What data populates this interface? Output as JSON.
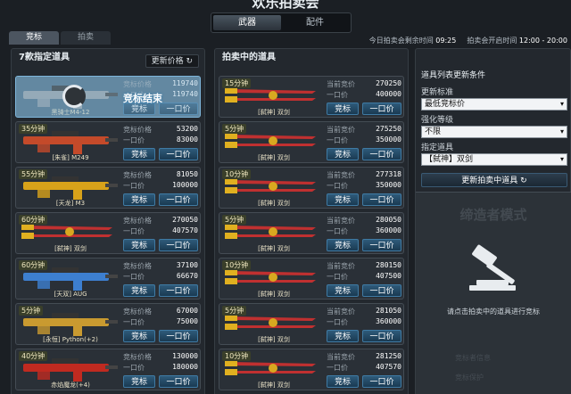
{
  "header": {
    "title": "欢乐拍卖会"
  },
  "category_tabs": [
    {
      "label": "武器"
    },
    {
      "label": "配件"
    }
  ],
  "sub_tabs": [
    {
      "label": "竞标"
    },
    {
      "label": "拍卖"
    }
  ],
  "timer": {
    "remaining_label": "今日拍卖会剩余时间",
    "remaining_value": "09:25",
    "open_label": "拍卖会开启时间",
    "open_value": "12:00 - 20:00"
  },
  "left_panel": {
    "title": "7款指定道具",
    "refresh_label": "更新价格",
    "items": [
      {
        "time": "",
        "name": "黑骑士M4-12",
        "label1": "竞标价格",
        "value1": "119740",
        "label2": "一口价",
        "value2": "119740",
        "bid": "竞标",
        "buy": "一口价",
        "ended": "竞标结束",
        "color": "#9aa1a8"
      },
      {
        "time": "35分钟",
        "name": "[朱雀] M249",
        "label1": "竞标价格",
        "value1": "53200",
        "label2": "一口价",
        "value2": "83000",
        "bid": "竞标",
        "buy": "一口价",
        "color": "#c44a2a"
      },
      {
        "time": "55分钟",
        "name": "[天龙] M3",
        "label1": "竞标价格",
        "value1": "81050",
        "label2": "一口价",
        "value2": "100000",
        "bid": "竞标",
        "buy": "一口价",
        "color": "#d8a21a"
      },
      {
        "time": "60分钟",
        "name": "[弑神] 双剑",
        "label1": "竞标价格",
        "value1": "270050",
        "label2": "一口价",
        "value2": "407570",
        "bid": "竞标",
        "buy": "一口价",
        "color": "#d03030"
      },
      {
        "time": "60分钟",
        "name": "[天双] AUG",
        "label1": "竞标价格",
        "value1": "37100",
        "label2": "一口价",
        "value2": "66670",
        "bid": "竞标",
        "buy": "一口价",
        "color": "#3d7fd0"
      },
      {
        "time": "5分钟",
        "name": "[永恒] Python(+2)",
        "label1": "竞标价格",
        "value1": "67000",
        "label2": "一口价",
        "value2": "75000",
        "bid": "竞标",
        "buy": "一口价",
        "color": "#c99a30"
      },
      {
        "time": "40分钟",
        "name": "赤焰魔龙(+4)",
        "label1": "竞标价格",
        "value1": "130000",
        "label2": "一口价",
        "value2": "180000",
        "bid": "竞标",
        "buy": "一口价",
        "color": "#c02a20"
      }
    ]
  },
  "mid_panel": {
    "title": "拍卖中的道具",
    "items": [
      {
        "time": "15分钟",
        "name": "[弑神] 双剑",
        "label1": "当前竞价",
        "value1": "270250",
        "label2": "一口价",
        "value2": "400000",
        "bid": "竞标",
        "buy": "一口价"
      },
      {
        "time": "5分钟",
        "name": "[弑神] 双剑",
        "label1": "当前竞价",
        "value1": "275250",
        "label2": "一口价",
        "value2": "350000",
        "bid": "竞标",
        "buy": "一口价"
      },
      {
        "time": "10分钟",
        "name": "[弑神] 双剑",
        "label1": "当前竞价",
        "value1": "277318",
        "label2": "一口价",
        "value2": "350000",
        "bid": "竞标",
        "buy": "一口价"
      },
      {
        "time": "5分钟",
        "name": "[弑神] 双剑",
        "label1": "当前竞价",
        "value1": "280050",
        "label2": "一口价",
        "value2": "360000",
        "bid": "竞标",
        "buy": "一口价"
      },
      {
        "time": "10分钟",
        "name": "[弑神] 双剑",
        "label1": "当前竞价",
        "value1": "280150",
        "label2": "一口价",
        "value2": "407500",
        "bid": "竞标",
        "buy": "一口价"
      },
      {
        "time": "5分钟",
        "name": "[弑神] 双剑",
        "label1": "当前竞价",
        "value1": "281050",
        "label2": "一口价",
        "value2": "360000",
        "bid": "竞标",
        "buy": "一口价"
      },
      {
        "time": "10分钟",
        "name": "[弑神] 双剑",
        "label1": "当前竞价",
        "value1": "281250",
        "label2": "一口价",
        "value2": "407570",
        "bid": "竞标",
        "buy": "一口价"
      }
    ]
  },
  "right_panel": {
    "filter_title": "道具列表更新条件",
    "sort_label": "更新标准",
    "sort_value": "最低竞标价",
    "enhance_label": "强化等级",
    "enhance_value": "不限",
    "item_label": "指定道具",
    "item_value": "【弑神】双剑",
    "refresh_button": "更新拍卖中道具",
    "creator_title": "缔造者模式",
    "creator_hint": "请点击拍卖中的道具进行竞标",
    "faded_row1": "竞标者信息",
    "faded_row2": "竞标保护"
  }
}
